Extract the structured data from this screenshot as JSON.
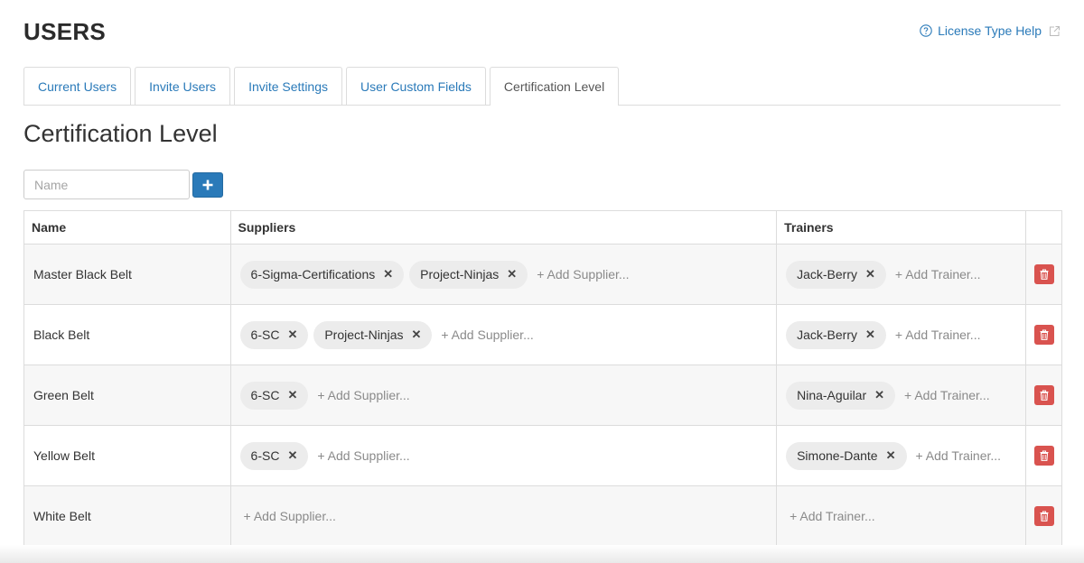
{
  "header": {
    "title": "USERS",
    "help_link": "License Type Help"
  },
  "tabs": [
    {
      "label": "Current Users",
      "active": false
    },
    {
      "label": "Invite Users",
      "active": false
    },
    {
      "label": "Invite Settings",
      "active": false
    },
    {
      "label": "User Custom Fields",
      "active": false
    },
    {
      "label": "Certification Level",
      "active": true
    }
  ],
  "section_title": "Certification Level",
  "new_level": {
    "placeholder": "Name",
    "value": ""
  },
  "table": {
    "columns": [
      "Name",
      "Suppliers",
      "Trainers",
      ""
    ],
    "add_supplier_label": "+ Add Supplier...",
    "add_trainer_label": "+ Add Trainer...",
    "rows": [
      {
        "name": "Master Black Belt",
        "suppliers": [
          "6-Sigma-Certifications",
          "Project-Ninjas"
        ],
        "trainers": [
          "Jack-Berry"
        ]
      },
      {
        "name": "Black Belt",
        "suppliers": [
          "6-SC",
          "Project-Ninjas"
        ],
        "trainers": [
          "Jack-Berry"
        ]
      },
      {
        "name": "Green Belt",
        "suppliers": [
          "6-SC"
        ],
        "trainers": [
          "Nina-Aguilar"
        ]
      },
      {
        "name": "Yellow Belt",
        "suppliers": [
          "6-SC"
        ],
        "trainers": [
          "Simone-Dante"
        ]
      },
      {
        "name": "White Belt",
        "suppliers": [],
        "trainers": []
      }
    ]
  },
  "icons": {
    "help": "question-circle-icon",
    "external": "external-link-icon",
    "add": "plus-icon",
    "remove": "close-icon",
    "delete": "trash-icon"
  },
  "colors": {
    "link": "#2a7ab9",
    "primary_button": "#2a7ab9",
    "danger_button": "#d9534f",
    "tag_background": "#ececec",
    "stripe": "#f7f7f7"
  }
}
